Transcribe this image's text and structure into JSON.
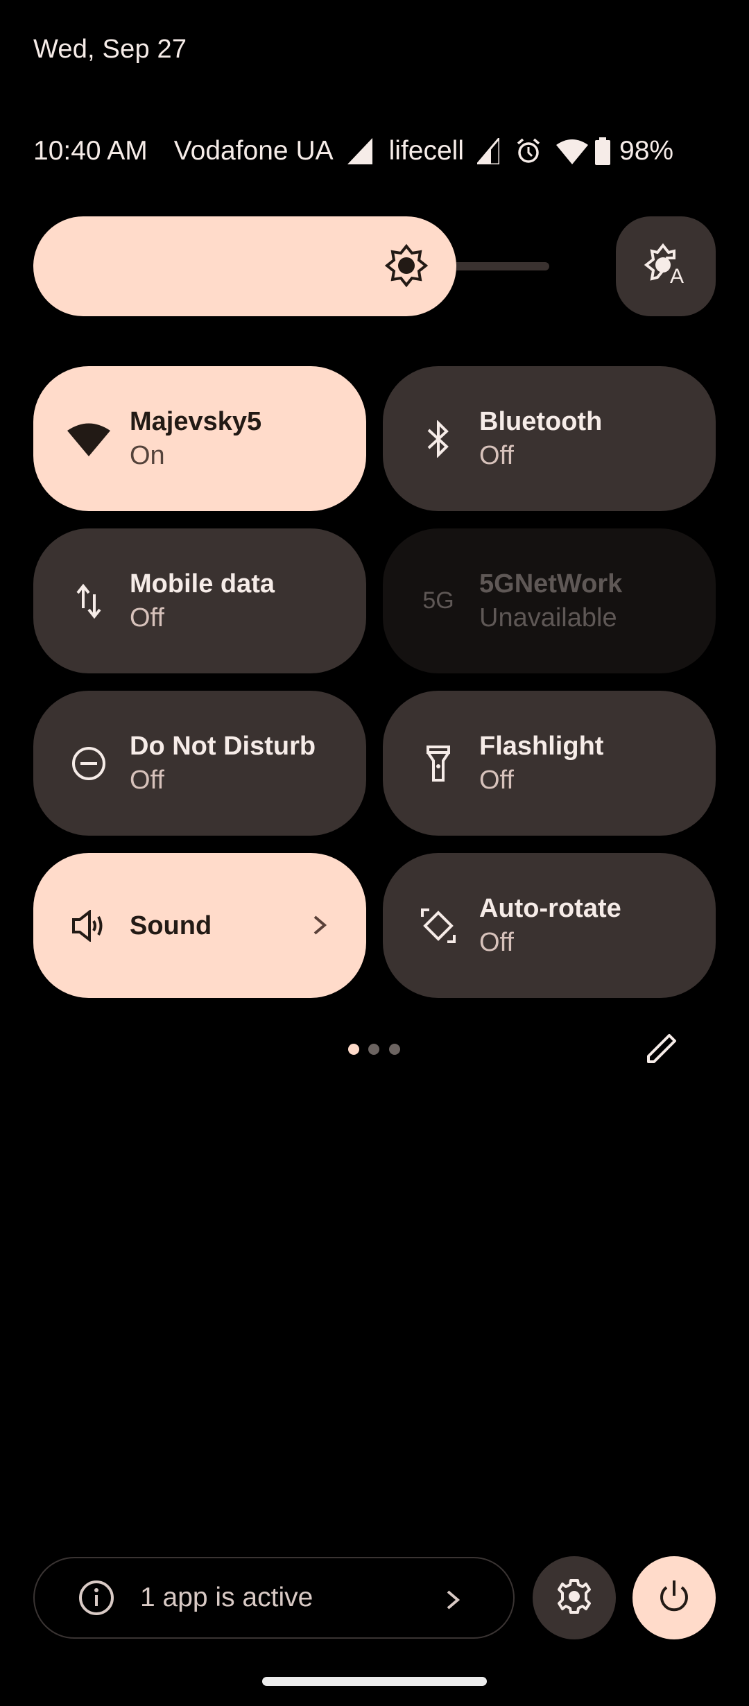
{
  "header": {
    "date": "Wed, Sep 27"
  },
  "status_bar": {
    "time": "10:40 AM",
    "carrier1": "Vodafone UA",
    "carrier1_icon": "signal-full-icon",
    "carrier2": "lifecell",
    "carrier2_icon": "signal-partial-icon",
    "alarm_icon": "alarm-icon",
    "wifi_icon": "wifi-icon",
    "battery_icon": "battery-icon",
    "battery": "98%"
  },
  "brightness": {
    "level": 0.82,
    "icon": "brightness-icon",
    "auto_icon": "auto-brightness-icon"
  },
  "tiles": [
    {
      "title": "Majevsky5",
      "subtitle": "On",
      "state": "on",
      "icon": "wifi-icon"
    },
    {
      "title": "Bluetooth",
      "subtitle": "Off",
      "state": "off",
      "icon": "bluetooth-icon"
    },
    {
      "title": "Mobile data",
      "subtitle": "Off",
      "state": "off",
      "icon": "mobile-data-icon"
    },
    {
      "title": "5GNetWork",
      "subtitle": "Unavailable",
      "state": "unavailable",
      "icon": "5g-icon",
      "icon_text": "5G"
    },
    {
      "title": "Do Not Disturb",
      "subtitle": "Off",
      "state": "off",
      "icon": "do-not-disturb-icon"
    },
    {
      "title": "Flashlight",
      "subtitle": "Off",
      "state": "off",
      "icon": "flashlight-icon"
    },
    {
      "title": "Sound",
      "subtitle": "",
      "state": "on",
      "icon": "sound-icon",
      "has_chevron": true
    },
    {
      "title": "Auto-rotate",
      "subtitle": "Off",
      "state": "off",
      "icon": "auto-rotate-icon"
    }
  ],
  "pager": {
    "pages": 3,
    "current": 1
  },
  "edit": {
    "icon": "edit-icon"
  },
  "footer": {
    "active_apps": "1 app is active",
    "info_icon": "info-icon",
    "settings_icon": "gear-icon",
    "power_icon": "power-icon"
  },
  "colors": {
    "accent": "#ffdbca",
    "tile_off": "#3a3230",
    "tile_unavailable": "#141110",
    "background": "#000000"
  }
}
